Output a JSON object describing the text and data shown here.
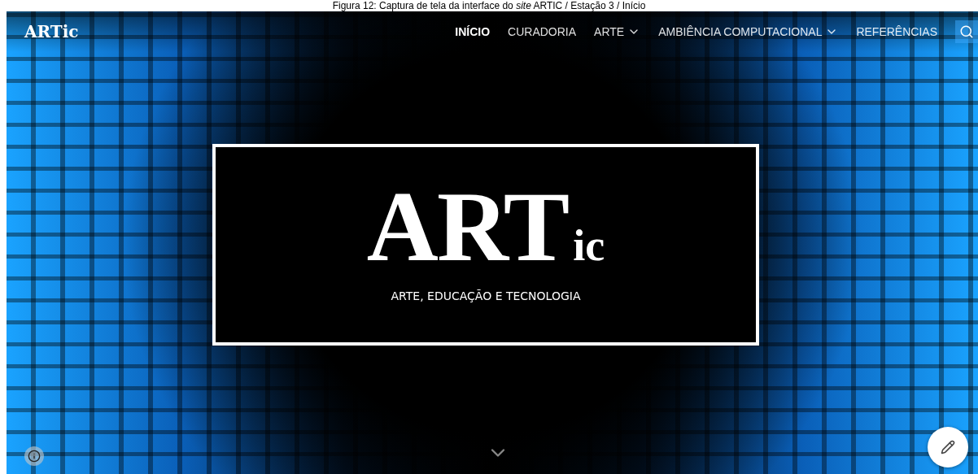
{
  "caption": "Figura 12: Captura de tela da interface do *site* ARTIC / Estação 3 / Início",
  "site": {
    "logo": "ARTic"
  },
  "nav": [
    {
      "label": "INÍCIO",
      "selected": true,
      "has_menu": false
    },
    {
      "label": "CURADORIA",
      "selected": false,
      "has_menu": false
    },
    {
      "label": "ARTE",
      "selected": false,
      "has_menu": true
    },
    {
      "label": "AMBIÊNCIA COMPUTACIONAL",
      "selected": false,
      "has_menu": true
    },
    {
      "label": "REFERÊNCIAS",
      "selected": false,
      "has_menu": false
    }
  ],
  "hero": {
    "title": "ART",
    "title_suffix": "ic",
    "subtitle": "ARTE, EDUCAÇÃO E TECNOLOGIA"
  }
}
